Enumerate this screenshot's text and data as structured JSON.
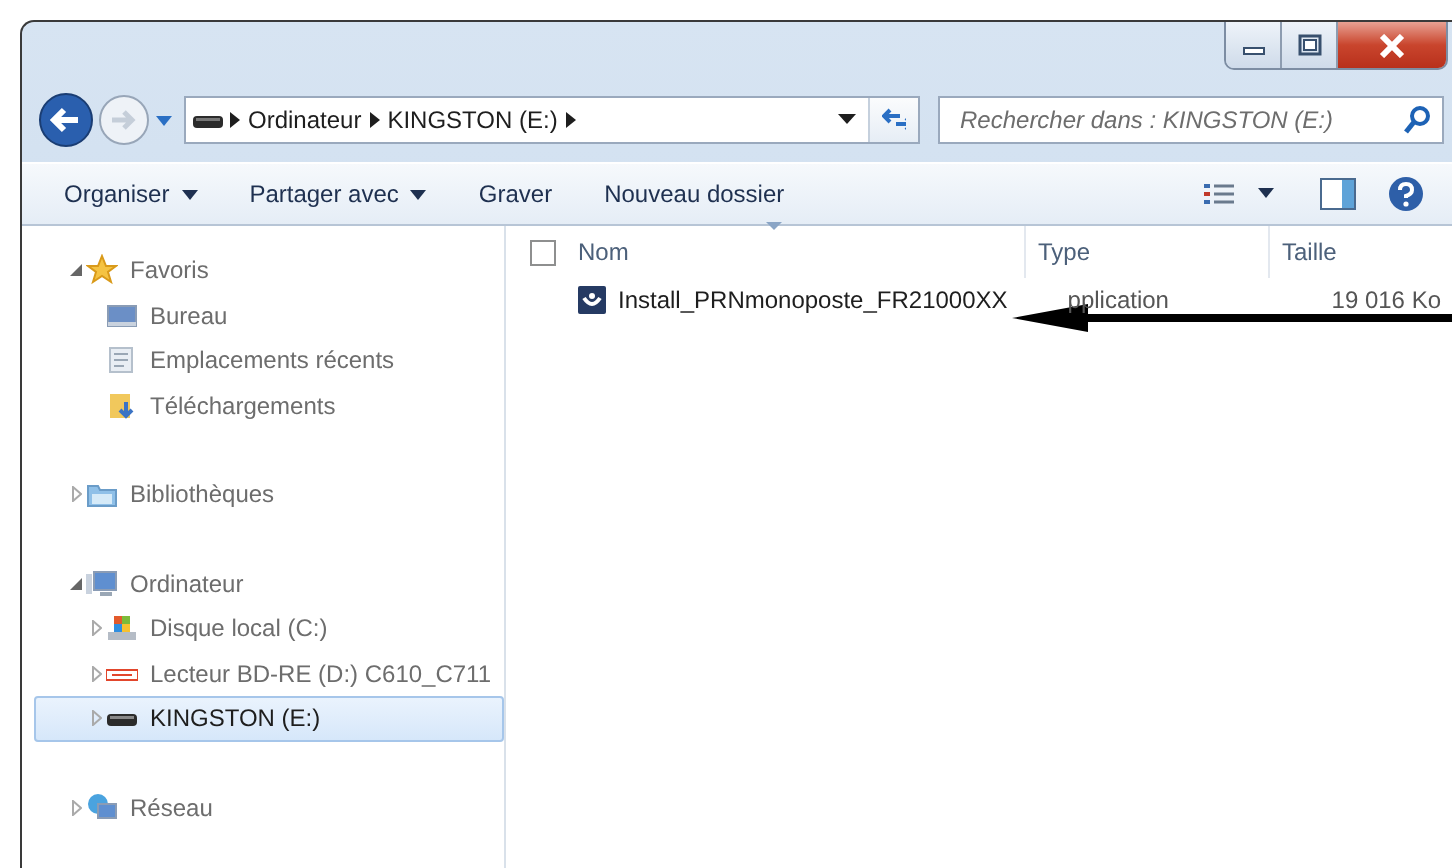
{
  "address_bar": {
    "path": [
      "Ordinateur",
      "KINGSTON (E:)"
    ]
  },
  "search": {
    "placeholder": "Rechercher dans : KINGSTON (E:)"
  },
  "toolbar": {
    "buttons": [
      {
        "label": "Organiser",
        "dropdown": true
      },
      {
        "label": "Partager avec",
        "dropdown": true
      },
      {
        "label": "Graver",
        "dropdown": false
      },
      {
        "label": "Nouveau dossier",
        "dropdown": false
      }
    ]
  },
  "nav": [
    {
      "label": "Favoris",
      "kind": "star",
      "expanded": true,
      "selected": false,
      "children": [
        {
          "label": "Bureau",
          "kind": "desktop",
          "selected": false
        },
        {
          "label": "Emplacements récents",
          "kind": "recent",
          "selected": false
        },
        {
          "label": "Téléchargements",
          "kind": "downloads",
          "selected": false
        }
      ]
    },
    {
      "label": "Bibliothèques",
      "kind": "library",
      "expanded": false,
      "selected": false
    },
    {
      "label": "Ordinateur",
      "kind": "computer",
      "expanded": true,
      "selected": false,
      "children": [
        {
          "label": "Disque local (C:)",
          "kind": "disk",
          "expanded": false,
          "selected": false
        },
        {
          "label": "Lecteur BD-RE (D:) C610_C711",
          "kind": "oki",
          "expanded": false,
          "selected": false
        },
        {
          "label": "KINGSTON (E:)",
          "kind": "usb",
          "expanded": false,
          "selected": true
        }
      ]
    },
    {
      "label": "Réseau",
      "kind": "network",
      "expanded": false,
      "selected": false
    }
  ],
  "file_list": {
    "select_all": {
      "checked": false
    },
    "columns": [
      {
        "label": "Nom",
        "sorted": true
      },
      {
        "label": "Type",
        "sorted": false
      },
      {
        "label": "Taille",
        "sorted": false
      }
    ],
    "rows": [
      {
        "name": "Install_PRNmonoposte_FR21000XX",
        "type": "pplication",
        "size": "19 016 Ko"
      }
    ]
  }
}
